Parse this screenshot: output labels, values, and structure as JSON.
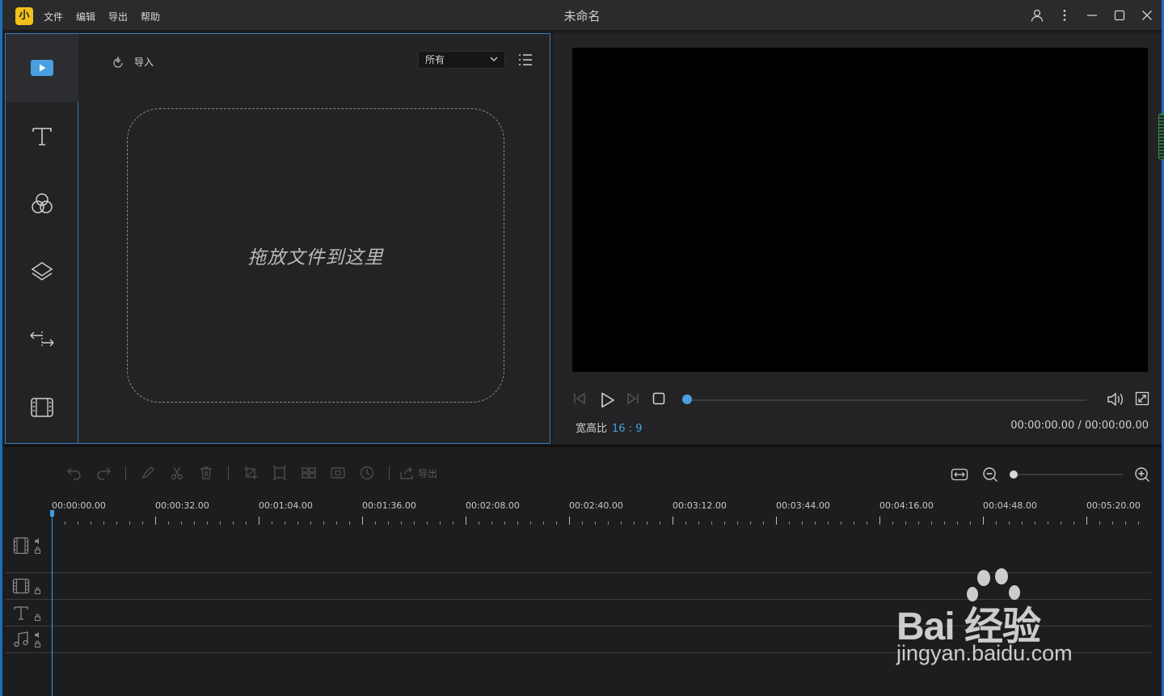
{
  "app": {
    "title": "未命名",
    "logo_glyph": "小"
  },
  "menu": [
    "文件",
    "编辑",
    "导出",
    "帮助"
  ],
  "media": {
    "import_label": "导入",
    "filter_value": "所有",
    "dropzone_text": "拖放文件到这里"
  },
  "preview": {
    "aspect_label": "宽高比",
    "aspect_value": "16 : 9",
    "time": "00:00:00.00 / 00:00:00.00",
    "progress": 0
  },
  "timeline": {
    "export_label": "导出",
    "ruler": [
      "00:00:00.00",
      "00:00:32.00",
      "00:01:04.00",
      "00:01:36.00",
      "00:02:08.00",
      "00:02:40.00",
      "00:03:12.00",
      "00:03:44.00",
      "00:04:16.00",
      "00:04:48.00",
      "00:05:20.00"
    ],
    "zoom": 0
  },
  "watermark": {
    "line1": "Bai 经验",
    "line2": "jingyan.baidu.com"
  },
  "colors": {
    "accent": "#4a9fe0",
    "logo": "#f2c21a",
    "border": "#3d7bbd"
  }
}
